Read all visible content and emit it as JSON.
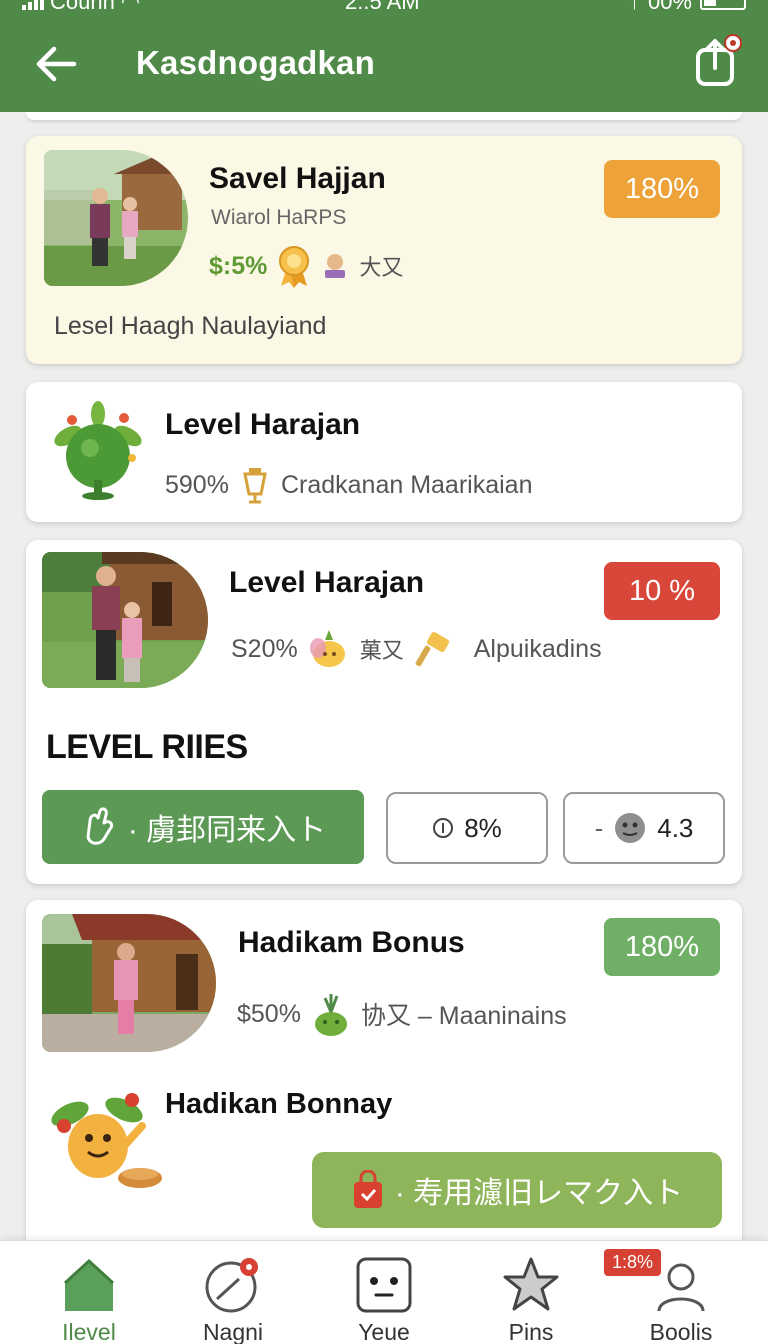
{
  "status_bar": {
    "carrier": "Couhn",
    "time": "2:.5 AM",
    "battery": "00%"
  },
  "app_bar": {
    "title": "Kasdnogadkan"
  },
  "cards": [
    {
      "name": "Savel Hajjan",
      "subtitle": "Wiarol HaRPS",
      "stat": "$:5%",
      "extra": "大又",
      "note": "Lesel Haagh Naulayiand",
      "badge": "180%",
      "badge_color": "#eda33a"
    },
    {
      "name": "Level Harajan",
      "stat": "590%",
      "extra": "Cradkanan Maarikaian"
    },
    {
      "name": "Level Harajan",
      "stat": "S20%",
      "extra": "菓又",
      "extra2": "Alpuikadins",
      "badge": "10 %",
      "badge_color": "#d9463a",
      "section_title": "LEVEL RIIES",
      "primary_button": "· 虜邽同来入ト",
      "chip_percent": "8%",
      "chip_rating": "4.3",
      "chip_dash": "-"
    },
    {
      "name": "Hadikam Bonus",
      "stat": "$50%",
      "extra": "协又 – Maaninains",
      "badge": "180%",
      "badge_color": "#6fb066",
      "sub_title": "Hadikan Bonnay",
      "secondary_button": "· 寿用濾旧レマク入ト"
    }
  ],
  "bottom_nav": [
    {
      "label": "Ilevel",
      "icon": "home-icon",
      "active": true
    },
    {
      "label": "Nagni",
      "icon": "compass-icon"
    },
    {
      "label": "Yeue",
      "icon": "face-icon"
    },
    {
      "label": "Pins",
      "icon": "star-icon"
    },
    {
      "label": "Boolis",
      "icon": "profile-icon",
      "badge": "1:8%"
    }
  ],
  "colors": {
    "primary": "#4f8a48",
    "button_green": "#5b9954",
    "button_olive": "#8fb55b",
    "featured_bg": "#fbf8e6"
  }
}
